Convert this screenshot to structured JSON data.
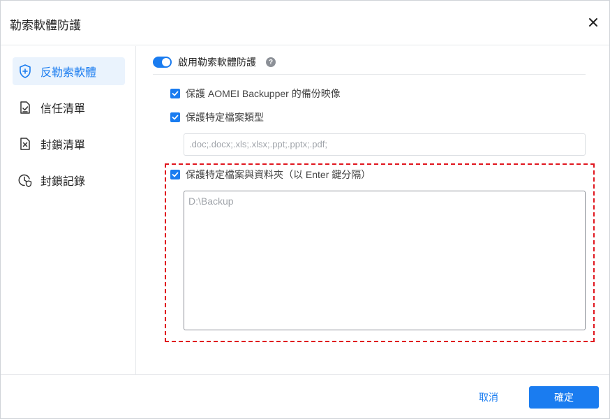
{
  "dialog": {
    "title": "勒索軟體防護"
  },
  "sidebar": {
    "items": [
      {
        "label": "反勒索軟體",
        "icon": "shield-plus-icon",
        "active": true
      },
      {
        "label": "信任清單",
        "icon": "document-check-icon",
        "active": false
      },
      {
        "label": "封鎖清單",
        "icon": "document-x-icon",
        "active": false
      },
      {
        "label": "封鎖記錄",
        "icon": "clock-shield-icon",
        "active": false
      }
    ]
  },
  "main": {
    "toggle_label": "啟用勒索軟體防護",
    "toggle_on": true,
    "help_icon": "?",
    "option_backup_image": "保護 AOMEI Backupper 的備份映像",
    "option_file_types": "保護特定檔案類型",
    "file_types_value": ".doc;.docx;.xls;.xlsx;.ppt;.pptx;.pdf;",
    "option_folders": "保護特定檔案與資料夾（以 Enter 鍵分隔）",
    "folders_value": "D:\\Backup"
  },
  "footer": {
    "cancel_label": "取消",
    "ok_label": "確定"
  },
  "colors": {
    "accent": "#1a7cf0",
    "highlight": "#e0161e"
  }
}
